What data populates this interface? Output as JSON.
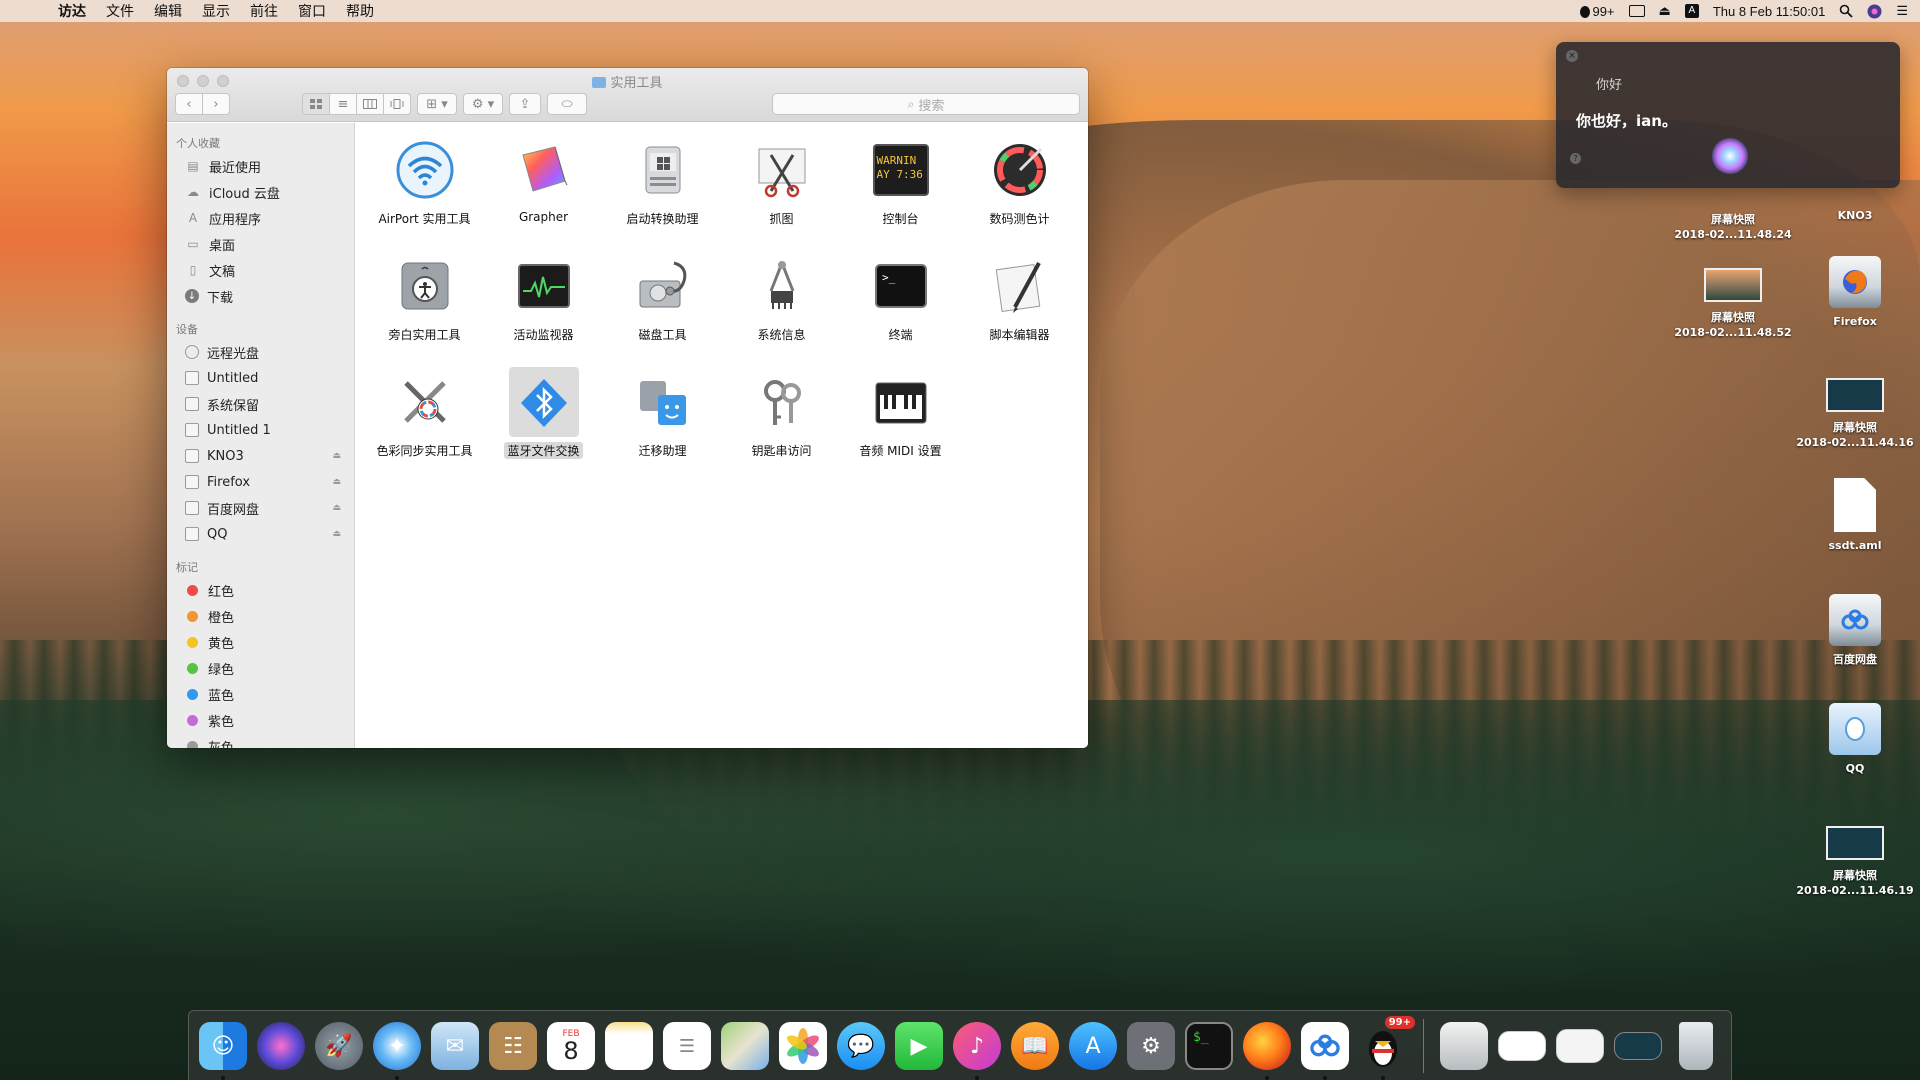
{
  "menubar": {
    "apple": "",
    "items": [
      "访达",
      "文件",
      "编辑",
      "显示",
      "前往",
      "窗口",
      "帮助"
    ],
    "qq_badge": "99+",
    "input_source": "A",
    "clock": "Thu 8 Feb  11:50:01"
  },
  "finder": {
    "title": "实用工具",
    "search_placeholder": "搜索",
    "sidebar": {
      "favorites_header": "个人收藏",
      "favorites": [
        "最近使用",
        "iCloud 云盘",
        "应用程序",
        "桌面",
        "文稿",
        "下载"
      ],
      "devices_header": "设备",
      "devices": [
        "远程光盘",
        "Untitled",
        "系统保留",
        "Untitled 1",
        "KNO3",
        "Firefox",
        "百度网盘",
        "QQ"
      ],
      "tags_header": "标记",
      "tags": [
        {
          "label": "红色",
          "color": "#f24a4a"
        },
        {
          "label": "橙色",
          "color": "#f5952f"
        },
        {
          "label": "黄色",
          "color": "#f5c51d"
        },
        {
          "label": "绿色",
          "color": "#56c443"
        },
        {
          "label": "蓝色",
          "color": "#2f9af2"
        },
        {
          "label": "紫色",
          "color": "#c56bd8"
        },
        {
          "label": "灰色",
          "color": "#9a9a9a"
        }
      ]
    },
    "apps": [
      {
        "label": "AirPort 实用工具",
        "icon": "airport-icon"
      },
      {
        "label": "Grapher",
        "icon": "grapher-icon"
      },
      {
        "label": "启动转换助理",
        "icon": "boot-camp-icon"
      },
      {
        "label": "抓图",
        "icon": "grab-icon"
      },
      {
        "label": "控制台",
        "icon": "console-icon"
      },
      {
        "label": "数码测色计",
        "icon": "color-meter-icon"
      },
      {
        "label": "旁白实用工具",
        "icon": "voiceover-icon"
      },
      {
        "label": "活动监视器",
        "icon": "activity-monitor-icon"
      },
      {
        "label": "磁盘工具",
        "icon": "disk-utility-icon"
      },
      {
        "label": "系统信息",
        "icon": "system-info-icon"
      },
      {
        "label": "终端",
        "icon": "terminal-icon"
      },
      {
        "label": "脚本编辑器",
        "icon": "script-editor-icon"
      },
      {
        "label": "色彩同步实用工具",
        "icon": "colorsync-icon"
      },
      {
        "label": "蓝牙文件交换",
        "icon": "bluetooth-icon"
      },
      {
        "label": "迁移助理",
        "icon": "migration-icon"
      },
      {
        "label": "钥匙串访问",
        "icon": "keychain-icon"
      },
      {
        "label": "音频 MIDI 设置",
        "icon": "midi-icon"
      }
    ],
    "console_text": "WARNIN\nAY 7:36",
    "selected_app": "蓝牙文件交换"
  },
  "siri": {
    "query": "你好",
    "reply": "你也好，ian。"
  },
  "desktop_icons": [
    {
      "label": "屏幕快照\n2018-02...11.48.24",
      "kind": "screenshot"
    },
    {
      "label": "KNO3",
      "kind": "disk"
    },
    {
      "label": "屏幕快照\n2018-02...11.48.52",
      "kind": "screenshot-photo"
    },
    {
      "label": "Firefox",
      "kind": "disk"
    },
    {
      "label": "屏幕快照\n2018-02...11.44.16",
      "kind": "screenshot"
    },
    {
      "label": "ssdt.aml",
      "kind": "doc"
    },
    {
      "label": "百度网盘",
      "kind": "disk"
    },
    {
      "label": "QQ",
      "kind": "disk"
    },
    {
      "label": "屏幕快照\n2018-02...11.46.19",
      "kind": "screenshot"
    }
  ],
  "dock": {
    "calendar_month": "FEB",
    "calendar_day": "8",
    "qq_badge": "99+",
    "items": [
      "finder",
      "siri",
      "launchpad",
      "safari",
      "mail",
      "contacts",
      "calendar",
      "notes",
      "reminders",
      "maps",
      "photos",
      "messages",
      "facetime",
      "itunes",
      "ibooks",
      "app-store",
      "system-preferences",
      "terminal",
      "firefox",
      "baidu-netdisk",
      "qq",
      "documents",
      "screenshot",
      "screenshot",
      "screenshot",
      "trash"
    ]
  }
}
